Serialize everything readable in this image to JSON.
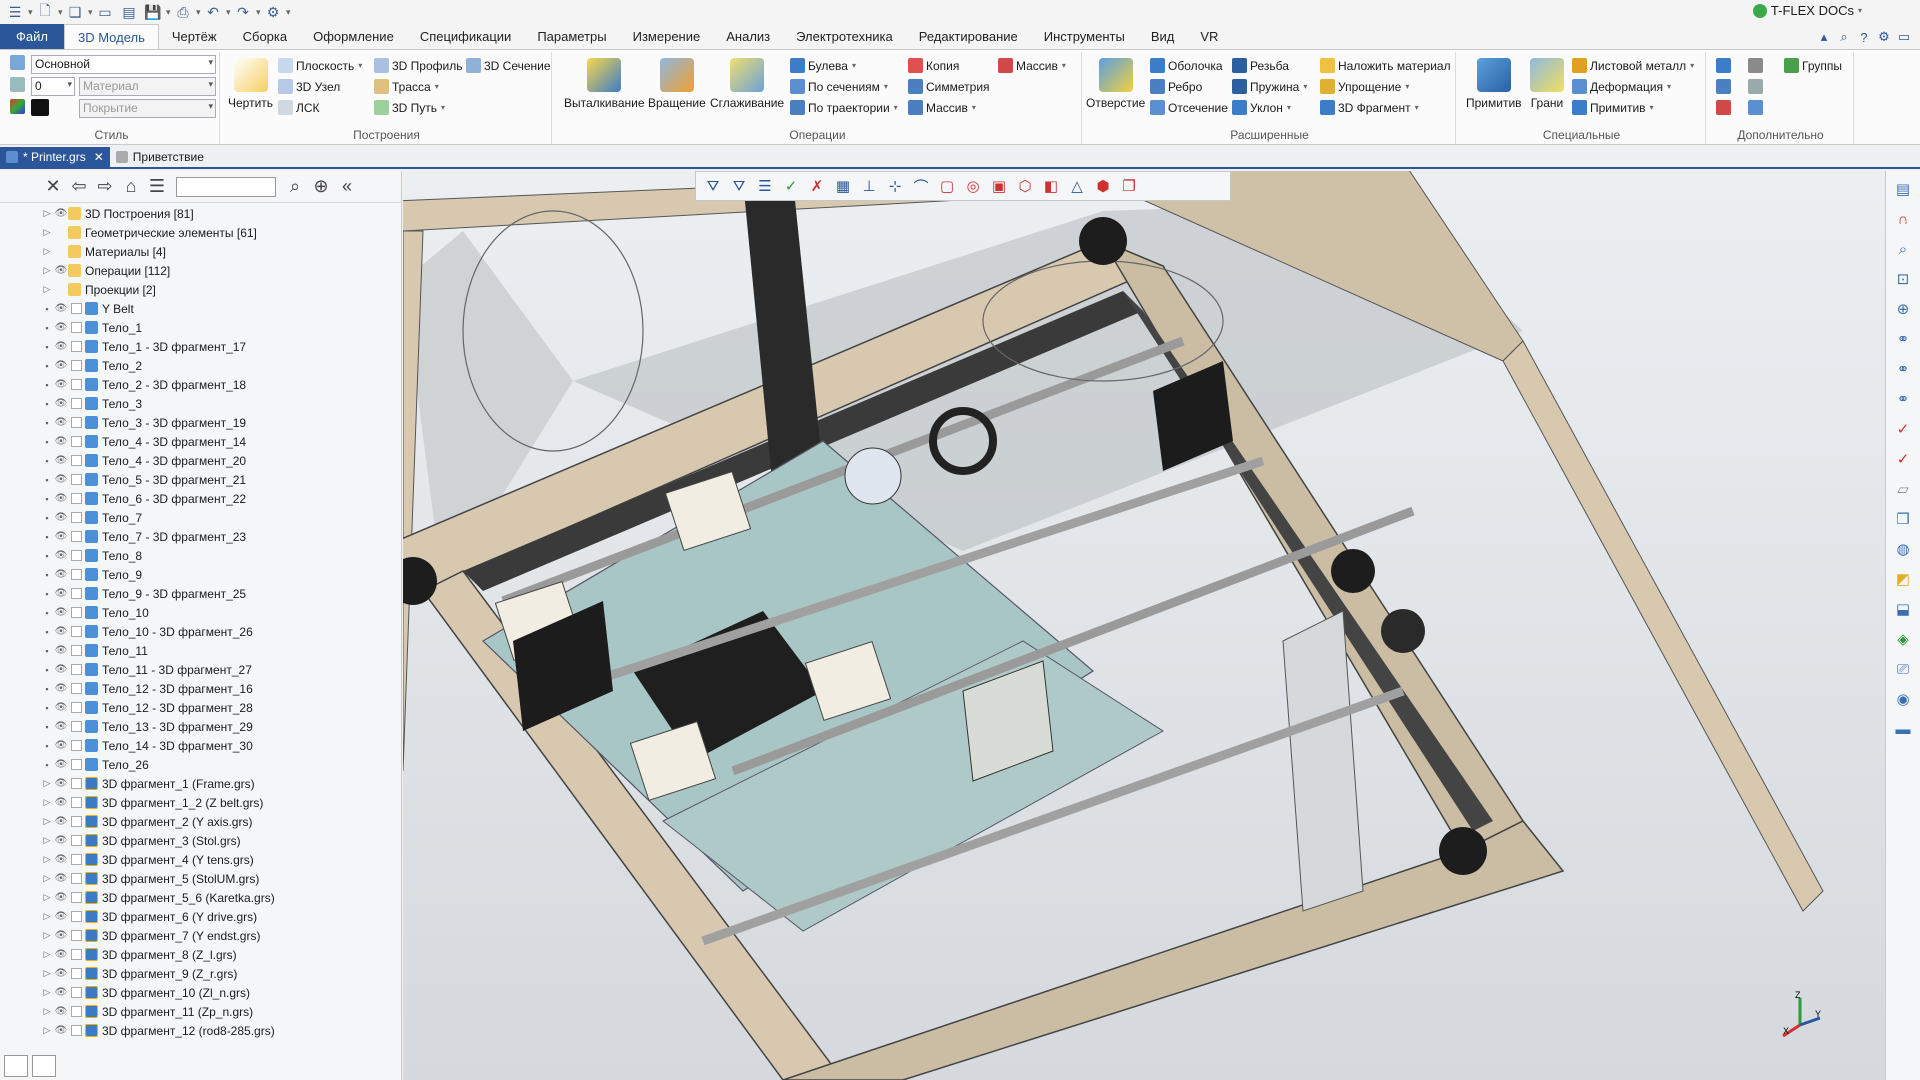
{
  "app": {
    "title": "T-FLEX DOCs"
  },
  "quick_access": {
    "icons": [
      "hamburger-icon",
      "new-file-icon",
      "open-icon",
      "window-icon",
      "save-icon",
      "print-icon",
      "undo-icon",
      "redo-icon",
      "macro-icon"
    ]
  },
  "menu": {
    "tabs": [
      "Файл",
      "3D Модель",
      "Чертёж",
      "Сборка",
      "Оформление",
      "Спецификации",
      "Параметры",
      "Измерение",
      "Анализ",
      "Электротехника",
      "Редактирование",
      "Инструменты",
      "Вид",
      "VR"
    ],
    "active": "3D Модель"
  },
  "ribbon": {
    "style": {
      "label": "Стиль",
      "layer": "Основной",
      "level": "0",
      "material_placeholder": "Материал",
      "coating_placeholder": "Покрытие"
    },
    "constructions": {
      "label": "Построения",
      "draw": "Чертить",
      "plane": "Плоскость",
      "node3d": "3D Узел",
      "lsk": "ЛСК",
      "profile3d": "3D Профиль",
      "path": "Трасса",
      "path3d": "3D Путь",
      "section3d": "3D Сечение"
    },
    "operations": {
      "label": "Операции",
      "extrude": "Выталкивание",
      "rotate": "Вращение",
      "smooth": "Сглаживание",
      "boolean": "Булева",
      "by_sections": "По сечениям",
      "by_path": "По траектории",
      "copy": "Копия",
      "symmetry": "Симметрия",
      "array": "Массив",
      "array2": "Массив"
    },
    "advanced": {
      "label": "Расширенные",
      "hole": "Отверстие",
      "shell": "Оболочка",
      "rib": "Ребро",
      "cut": "Отсечение",
      "thread": "Резьба",
      "spring": "Пружина",
      "slope": "Уклон",
      "apply_material": "Наложить материал",
      "simplify": "Упрощение",
      "fragment3d": "3D Фрагмент"
    },
    "special": {
      "label": "Специальные",
      "primitives": "Примитив",
      "faces": "Грани",
      "sheet_metal": "Листовой металл",
      "deform": "Деформация",
      "primitives2": "Примитив"
    },
    "extra": {
      "label": "Дополнительно",
      "groups": "Группы"
    }
  },
  "doc_tabs": [
    {
      "label": "* Printer.grs",
      "active": true
    },
    {
      "label": "Приветствие",
      "active": false
    }
  ],
  "tree": [
    {
      "label": "3D Построения [81]",
      "type": "folder",
      "expand": true,
      "eye": true
    },
    {
      "label": "Геометрические элементы [61]",
      "type": "folder",
      "expand": true,
      "eye": false
    },
    {
      "label": "Материалы [4]",
      "type": "folder",
      "expand": true,
      "eye": false
    },
    {
      "label": "Операции [112]",
      "type": "folder",
      "expand": true,
      "eye": true
    },
    {
      "label": "Проекции [2]",
      "type": "folder",
      "expand": true,
      "eye": false
    },
    {
      "label": "Y Belt",
      "type": "body"
    },
    {
      "label": "Тело_1",
      "type": "body"
    },
    {
      "label": "Тело_1 - 3D фрагмент_17",
      "type": "body"
    },
    {
      "label": "Тело_2",
      "type": "body"
    },
    {
      "label": "Тело_2 - 3D фрагмент_18",
      "type": "body"
    },
    {
      "label": "Тело_3",
      "type": "body"
    },
    {
      "label": "Тело_3 - 3D фрагмент_19",
      "type": "body"
    },
    {
      "label": "Тело_4 - 3D фрагмент_14",
      "type": "body"
    },
    {
      "label": "Тело_4 - 3D фрагмент_20",
      "type": "body"
    },
    {
      "label": "Тело_5 - 3D фрагмент_21",
      "type": "body"
    },
    {
      "label": "Тело_6 - 3D фрагмент_22",
      "type": "body"
    },
    {
      "label": "Тело_7",
      "type": "body"
    },
    {
      "label": "Тело_7 - 3D фрагмент_23",
      "type": "body"
    },
    {
      "label": "Тело_8",
      "type": "body"
    },
    {
      "label": "Тело_9",
      "type": "body"
    },
    {
      "label": "Тело_9 - 3D фрагмент_25",
      "type": "body"
    },
    {
      "label": "Тело_10",
      "type": "body"
    },
    {
      "label": "Тело_10 - 3D фрагмент_26",
      "type": "body"
    },
    {
      "label": "Тело_11",
      "type": "body"
    },
    {
      "label": "Тело_11 - 3D фрагмент_27",
      "type": "body"
    },
    {
      "label": "Тело_12 - 3D фрагмент_16",
      "type": "body"
    },
    {
      "label": "Тело_12 - 3D фрагмент_28",
      "type": "body"
    },
    {
      "label": "Тело_13 - 3D фрагмент_29",
      "type": "body"
    },
    {
      "label": "Тело_14 - 3D фрагмент_30",
      "type": "body"
    },
    {
      "label": "Тело_26",
      "type": "body"
    },
    {
      "label": "3D фрагмент_1 (Frame.grs)",
      "type": "frag",
      "expand": true
    },
    {
      "label": "3D фрагмент_1_2 (Z belt.grs)",
      "type": "frag",
      "expand": true
    },
    {
      "label": "3D фрагмент_2 (Y axis.grs)",
      "type": "frag",
      "expand": true
    },
    {
      "label": "3D фрагмент_3 (Stol.grs)",
      "type": "frag",
      "expand": true
    },
    {
      "label": "3D фрагмент_4 (Y tens.grs)",
      "type": "frag",
      "expand": true
    },
    {
      "label": "3D фрагмент_5 (StolUM.grs)",
      "type": "frag",
      "expand": true
    },
    {
      "label": "3D фрагмент_5_6 (Karetka.grs)",
      "type": "frag",
      "expand": true
    },
    {
      "label": "3D фрагмент_6 (Y drive.grs)",
      "type": "frag",
      "expand": true
    },
    {
      "label": "3D фрагмент_7 (Y endst.grs)",
      "type": "frag",
      "expand": true
    },
    {
      "label": "3D фрагмент_8 (Z_l.grs)",
      "type": "frag",
      "expand": true
    },
    {
      "label": "3D фрагмент_9 (Z_r.grs)",
      "type": "frag",
      "expand": true
    },
    {
      "label": "3D фрагмент_10 (Zl_n.grs)",
      "type": "frag",
      "expand": true
    },
    {
      "label": "3D фрагмент_11 (Zp_n.grs)",
      "type": "frag",
      "expand": true
    },
    {
      "label": "3D фрагмент_12 (rod8-285.grs)",
      "type": "frag",
      "expand": true
    }
  ],
  "axes": {
    "x": "X",
    "y": "Y",
    "z": "Z"
  },
  "colors": {
    "accent": "#2b579a",
    "frame": "#d8c8b0",
    "plate": "#a9c6c6"
  }
}
